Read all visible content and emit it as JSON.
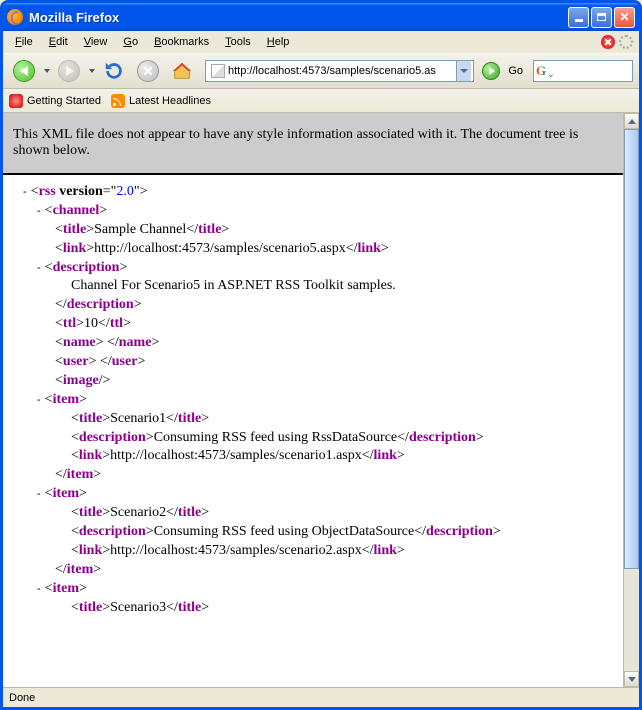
{
  "window": {
    "title": "Mozilla Firefox"
  },
  "menubar": {
    "file": "File",
    "edit": "Edit",
    "view": "View",
    "go": "Go",
    "bookmarks": "Bookmarks",
    "tools": "Tools",
    "help": "Help"
  },
  "toolbar": {
    "go": "Go",
    "url": "http://localhost:4573/samples/scenario5.as",
    "search": ""
  },
  "bookmarks_bar": {
    "getting_started": "Getting Started",
    "latest_headlines": "Latest Headlines"
  },
  "xml_notice": "This XML file does not appear to have any style information associated with it. The document tree is shown below.",
  "rss": {
    "version": "2.0",
    "channel": {
      "title": "Sample Channel",
      "link": "http://localhost:4573/samples/scenario5.aspx",
      "description": "Channel For Scenario5 in ASP.NET RSS Toolkit samples.",
      "ttl": "10",
      "name": "",
      "user": "",
      "items": [
        {
          "title": "Scenario1",
          "description": "Consuming RSS feed using RssDataSource",
          "link": "http://localhost:4573/samples/scenario1.aspx"
        },
        {
          "title": "Scenario2",
          "description": "Consuming RSS feed using ObjectDataSource",
          "link": "http://localhost:4573/samples/scenario2.aspx"
        },
        {
          "title": "Scenario3"
        }
      ]
    }
  },
  "status": "Done"
}
